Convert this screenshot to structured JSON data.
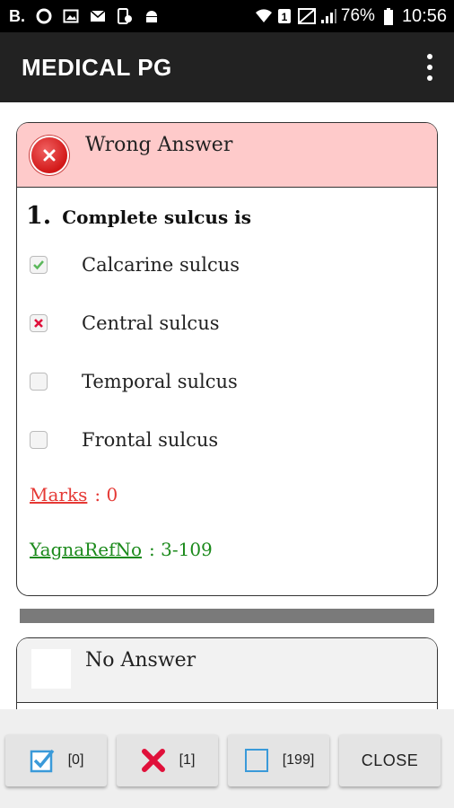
{
  "status_bar": {
    "left_icons": [
      "b-letter-icon",
      "circle-icon",
      "image-icon",
      "mail-icon",
      "device-icon",
      "android-icon"
    ],
    "b_label": "B.",
    "battery": "76%",
    "time": "10:56"
  },
  "app_bar": {
    "title": "MEDICAL PG",
    "menu_icon": "more-vert-icon"
  },
  "cards": [
    {
      "status": "Wrong Answer",
      "status_color": "#fecaca",
      "question_number": "1.",
      "question_text": "Complete sulcus is",
      "options": [
        {
          "label": "Calcarine sulcus",
          "mark": "correct"
        },
        {
          "label": "Central sulcus",
          "mark": "wrong"
        },
        {
          "label": "Temporal sulcus",
          "mark": "none"
        },
        {
          "label": "Frontal sulcus",
          "mark": "none"
        }
      ],
      "marks_label": "Marks",
      "marks_value": ": 0",
      "ref_label": "YagnaRefNo",
      "ref_value": ": 3-109"
    },
    {
      "status": "No Answer",
      "status_color": "#f2f2f2"
    }
  ],
  "bottom_bar": {
    "correct_count": "[0]",
    "wrong_count": "[1]",
    "unanswered_count": "[199]",
    "close_label": "CLOSE"
  },
  "colors": {
    "correct_check": "#5cb85c",
    "wrong_x": "#e0103a",
    "checkbox_blue": "#3a9ad9",
    "marks_red": "#e53935",
    "ref_green": "#1b8a1b"
  }
}
